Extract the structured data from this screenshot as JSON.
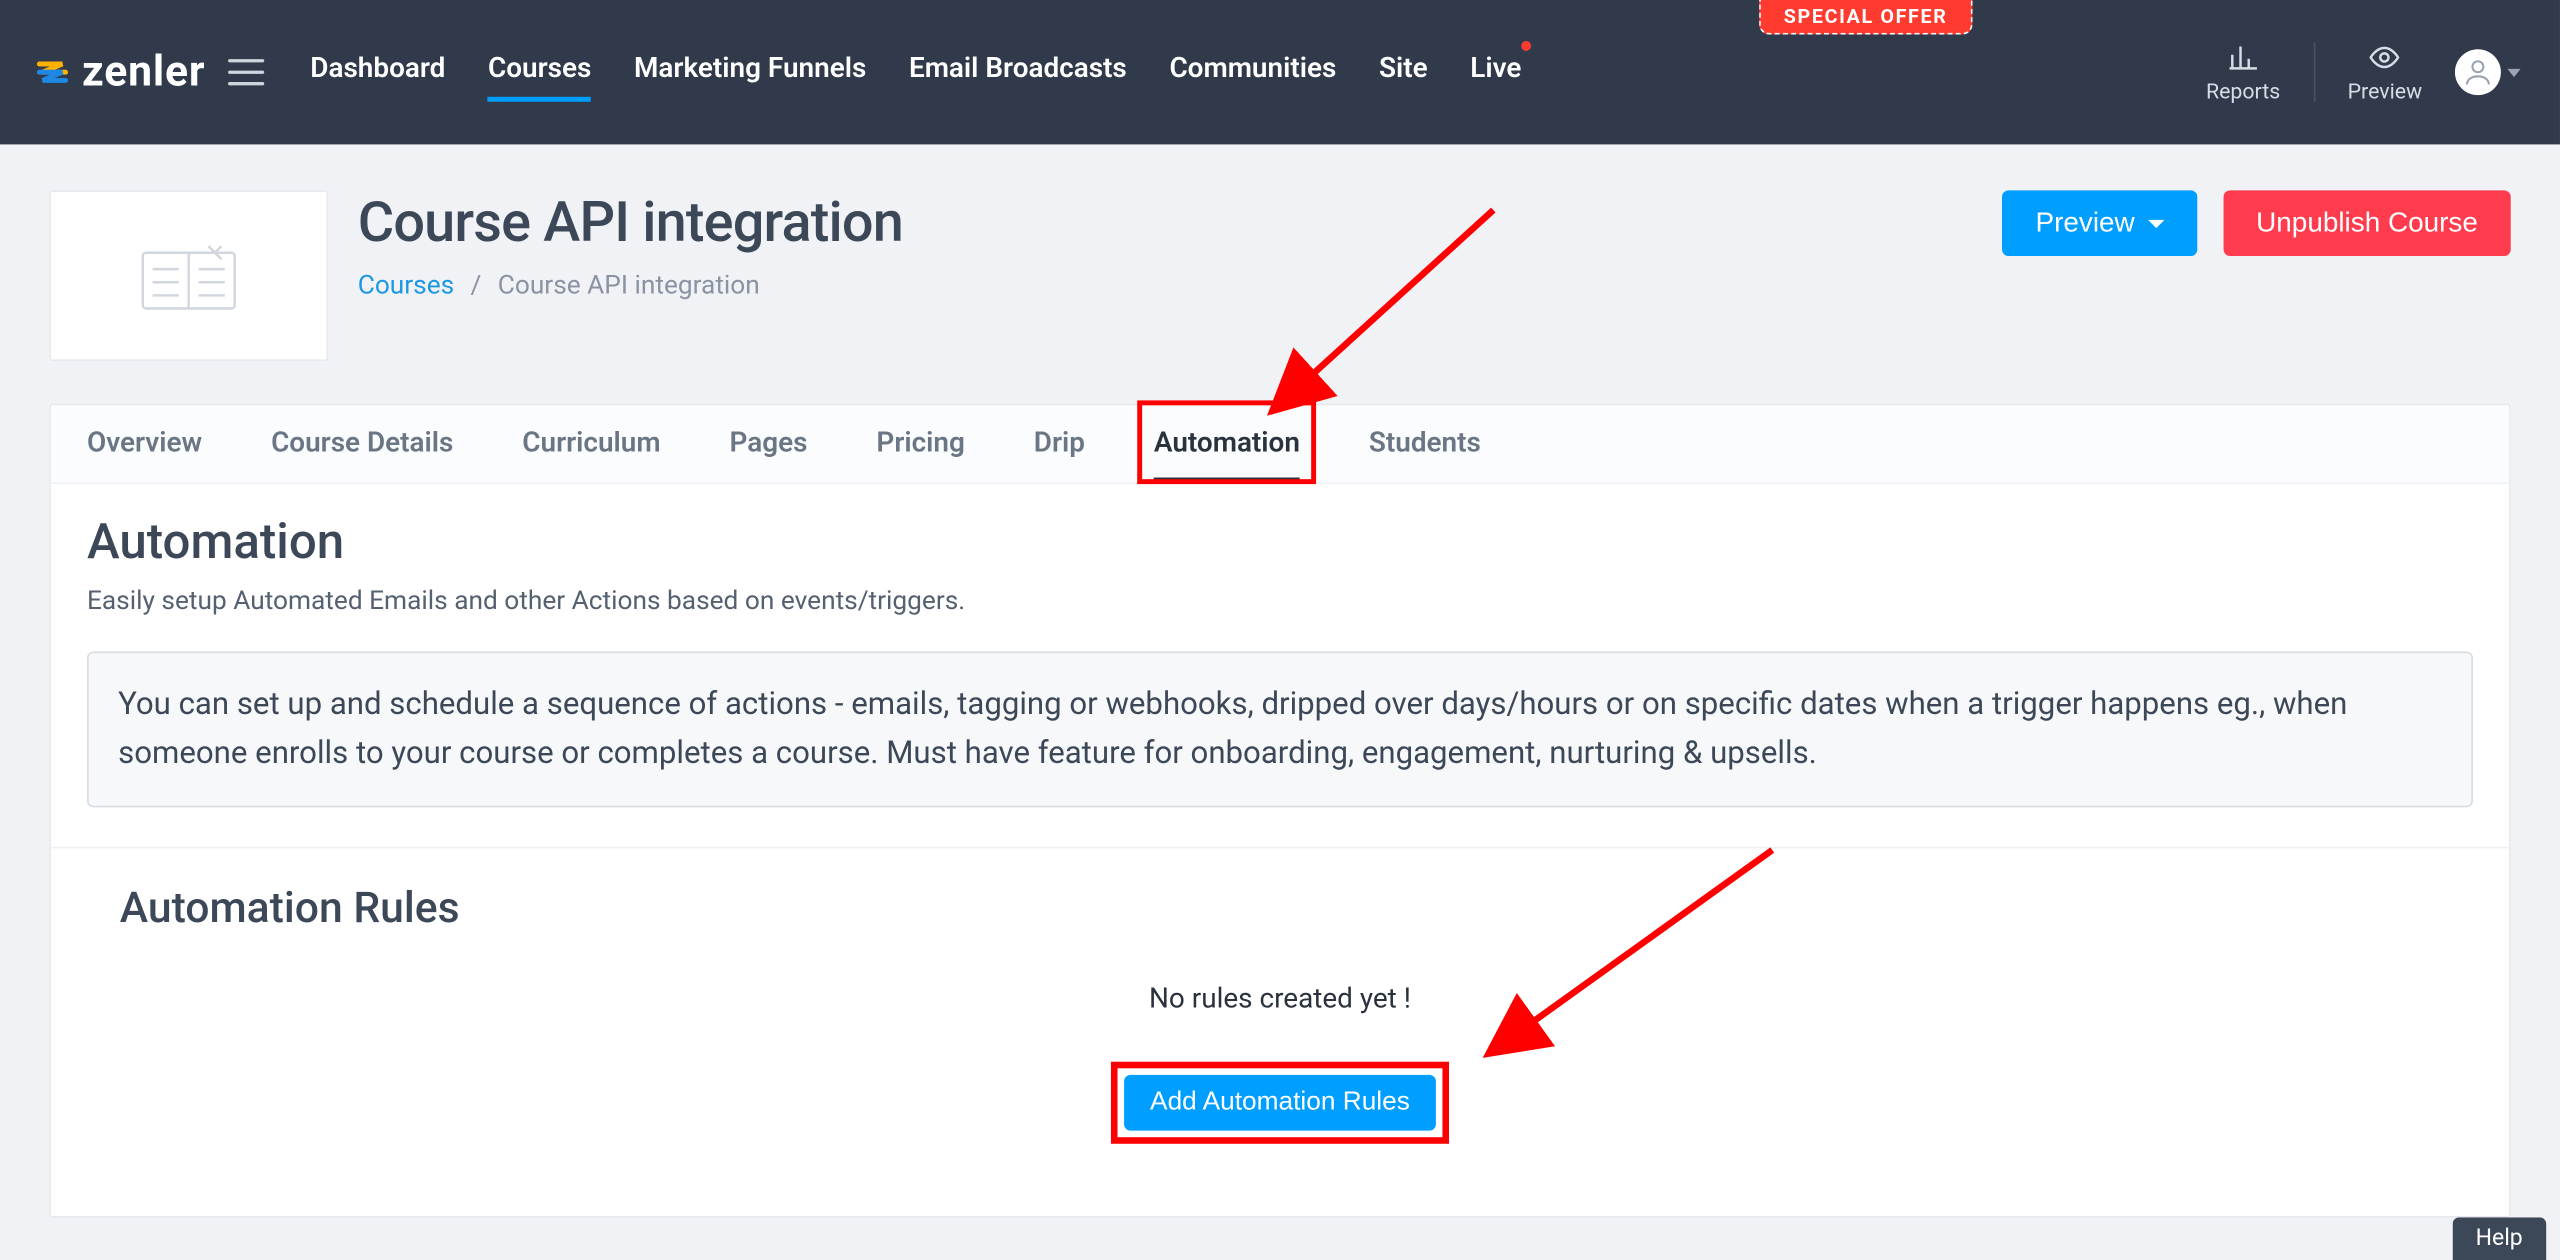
{
  "brand": {
    "name": "zenler"
  },
  "special_offer": "SPECIAL OFFER",
  "topnav": {
    "items": [
      {
        "label": "Dashboard"
      },
      {
        "label": "Courses",
        "active": true
      },
      {
        "label": "Marketing Funnels"
      },
      {
        "label": "Email Broadcasts"
      },
      {
        "label": "Communities"
      },
      {
        "label": "Site"
      },
      {
        "label": "Live",
        "has_dot": true
      }
    ],
    "reports": "Reports",
    "preview": "Preview"
  },
  "header": {
    "title": "Course API integration",
    "breadcrumb": {
      "root": "Courses",
      "current": "Course API integration"
    },
    "actions": {
      "preview": "Preview",
      "unpublish": "Unpublish Course"
    }
  },
  "tabs": [
    "Overview",
    "Course Details",
    "Curriculum",
    "Pages",
    "Pricing",
    "Drip",
    "Automation",
    "Students"
  ],
  "tabs_active_index": 6,
  "automation": {
    "heading": "Automation",
    "lead": "Easily setup Automated Emails and other Actions based on events/triggers.",
    "notice": "You can set up and schedule a sequence of actions - emails, tagging or webhooks, dripped over days/hours or on specific dates when a trigger happens eg., when someone enrolls to your course or completes a course. Must have feature for onboarding, engagement, nurturing & upsells.",
    "rules_heading": "Automation Rules",
    "empty_text": "No rules created yet !",
    "add_button": "Add Automation Rules"
  },
  "help": "Help"
}
